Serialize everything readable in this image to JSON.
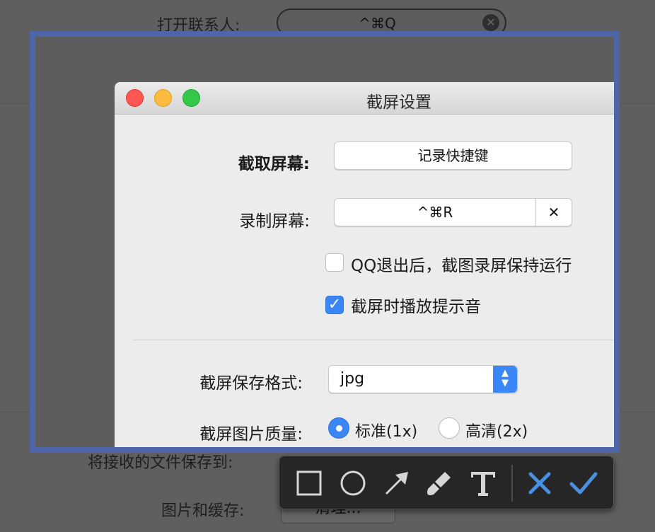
{
  "background": {
    "open_contacts_label": "打开联系人:",
    "open_contacts_shortcut": "^⌘Q",
    "save_files_label": "将接收的文件保存到:",
    "images_cache_label": "图片和缓存:",
    "clear_button": "清理..."
  },
  "window": {
    "title": "截屏设置",
    "capture_label": "截取屏幕:",
    "capture_button": "记录快捷键",
    "record_label": "录制屏幕:",
    "record_shortcut": "^⌘R",
    "record_clear": "✕",
    "keep_running_label": "QQ退出后，截图录屏保持运行",
    "keep_running_checked": false,
    "play_sound_label": "截屏时播放提示音",
    "play_sound_checked": true,
    "format_label": "截屏保存格式:",
    "format_value": "jpg",
    "quality_label": "截屏图片质量:",
    "quality_options": [
      "标准(1x)",
      "高清(2x)"
    ],
    "quality_selected": "标准(1x)"
  },
  "toolbar": {
    "tools": [
      "rectangle-icon",
      "ellipse-icon",
      "arrow-icon",
      "brush-icon",
      "text-icon",
      "cancel-icon",
      "confirm-icon"
    ]
  },
  "colors": {
    "selection_border": "#4e66a8",
    "accent": "#3a86f6",
    "cancel": "#4a90e2",
    "confirm": "#4a90e2"
  }
}
